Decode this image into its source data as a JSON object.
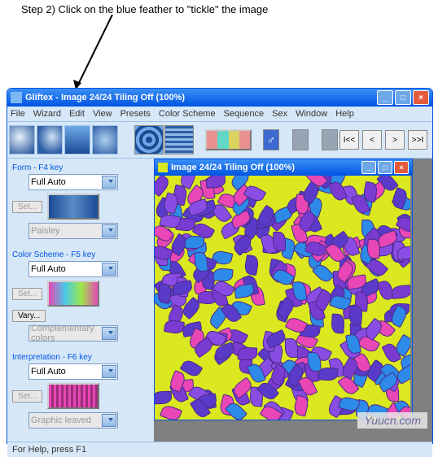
{
  "annotation": "Step 2) Click on the blue feather to \"tickle\" the image",
  "window": {
    "title": "Gliftex -   Image 24/24 Tiling Off (100%)",
    "menu": [
      "File",
      "Wizard",
      "Edit",
      "View",
      "Presets",
      "Color Scheme",
      "Sequence",
      "Sex",
      "Window",
      "Help"
    ],
    "minimize": "_",
    "maximize": "□",
    "close": "×"
  },
  "nav": {
    "first": "I<<",
    "prev": "<",
    "next": ">",
    "last": ">>I"
  },
  "panels": {
    "form": {
      "title": "Form - F4 key",
      "combo": "Full Auto",
      "set": "Set...",
      "disabled": "Paisley"
    },
    "color": {
      "title": "Color Scheme - F5 key",
      "combo": "Full Auto",
      "set": "Set...",
      "vary": "Vary...",
      "disabled": "Complementary colors"
    },
    "interp": {
      "title": "Interpretation - F6 key",
      "combo": "Full Auto",
      "set": "Set...",
      "disabled": "Graphic leaved"
    }
  },
  "doc": {
    "title": "Image 24/24 Tiling Off (100%)"
  },
  "status": "For Help, press F1",
  "watermark": "Yuucn.com"
}
